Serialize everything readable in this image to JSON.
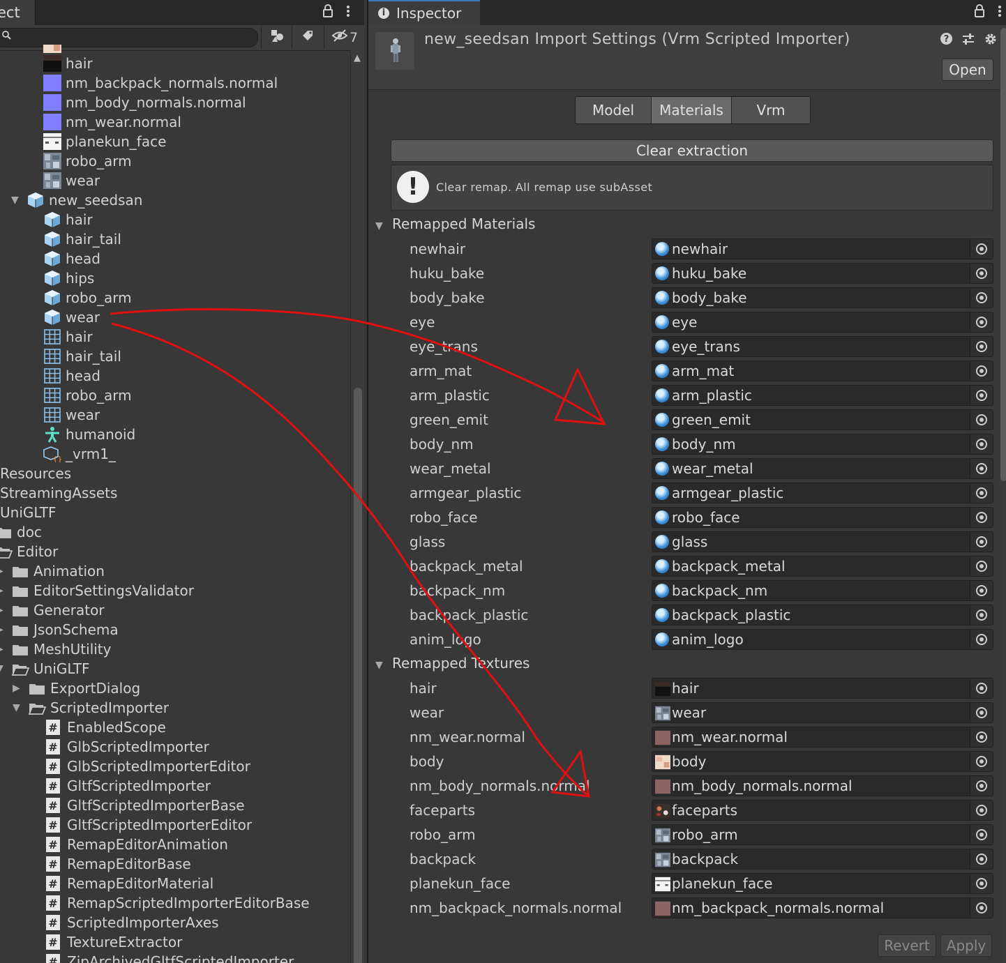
{
  "project": {
    "tab_label": "ect",
    "tab_icons": [
      "lock-icon",
      "kebab-menu-icon"
    ],
    "search_placeholder": "",
    "toolbar": {
      "hidden_count": "7"
    },
    "tree": [
      {
        "label": "hair",
        "icon": "texture-dark",
        "indent": 62
      },
      {
        "label": "nm_backpack_normals.normal",
        "icon": "texture-normal",
        "indent": 62
      },
      {
        "label": "nm_body_normals.normal",
        "icon": "texture-normal",
        "indent": 62
      },
      {
        "label": "nm_wear.normal",
        "icon": "texture-normal",
        "indent": 62
      },
      {
        "label": "planekun_face",
        "icon": "texture-face",
        "indent": 62
      },
      {
        "label": "robo_arm",
        "icon": "texture-robo",
        "indent": 62
      },
      {
        "label": "wear",
        "icon": "texture-robo",
        "indent": 62
      },
      {
        "label": "new_seedsan",
        "icon": "prefab",
        "indent": 38,
        "arrow": "down"
      },
      {
        "label": "hair",
        "icon": "prefab",
        "indent": 62
      },
      {
        "label": "hair_tail",
        "icon": "prefab",
        "indent": 62
      },
      {
        "label": "head",
        "icon": "prefab",
        "indent": 62
      },
      {
        "label": "hips",
        "icon": "prefab",
        "indent": 62
      },
      {
        "label": "robo_arm",
        "icon": "prefab",
        "indent": 62
      },
      {
        "label": "wear",
        "icon": "prefab",
        "indent": 62
      },
      {
        "label": "hair",
        "icon": "mesh",
        "indent": 62
      },
      {
        "label": "hair_tail",
        "icon": "mesh",
        "indent": 62
      },
      {
        "label": "head",
        "icon": "mesh",
        "indent": 62
      },
      {
        "label": "robo_arm",
        "icon": "mesh",
        "indent": 62
      },
      {
        "label": "wear",
        "icon": "mesh",
        "indent": 62
      },
      {
        "label": "humanoid",
        "icon": "humanoid",
        "indent": 62
      },
      {
        "label": "_vrm1_",
        "icon": "vrm",
        "indent": 62
      },
      {
        "label": "Resources",
        "icon": "none",
        "indent": 0
      },
      {
        "label": "StreamingAssets",
        "icon": "none",
        "indent": 0
      },
      {
        "label": "UniGLTF",
        "icon": "none",
        "indent": 0
      },
      {
        "label": "doc",
        "icon": "folder",
        "indent": -8
      },
      {
        "label": "Editor",
        "icon": "folder-open",
        "indent": -8
      },
      {
        "label": "Animation",
        "icon": "folder",
        "indent": 16,
        "arrow": "right"
      },
      {
        "label": "EditorSettingsValidator",
        "icon": "folder",
        "indent": 16,
        "arrow": "right"
      },
      {
        "label": "Generator",
        "icon": "folder",
        "indent": 16,
        "arrow": "right"
      },
      {
        "label": "JsonSchema",
        "icon": "folder",
        "indent": 16,
        "arrow": "right"
      },
      {
        "label": "MeshUtility",
        "icon": "folder",
        "indent": 16,
        "arrow": "right"
      },
      {
        "label": "UniGLTF",
        "icon": "folder-open",
        "indent": 16,
        "arrow": "down"
      },
      {
        "label": "ExportDialog",
        "icon": "folder",
        "indent": 40,
        "arrow": "right"
      },
      {
        "label": "ScriptedImporter",
        "icon": "folder-open",
        "indent": 40,
        "arrow": "down"
      },
      {
        "label": "EnabledScope",
        "icon": "script",
        "indent": 64
      },
      {
        "label": "GlbScriptedImporter",
        "icon": "script",
        "indent": 64
      },
      {
        "label": "GlbScriptedImporterEditor",
        "icon": "script",
        "indent": 64
      },
      {
        "label": "GltfScriptedImporter",
        "icon": "script",
        "indent": 64
      },
      {
        "label": "GltfScriptedImporterBase",
        "icon": "script",
        "indent": 64
      },
      {
        "label": "GltfScriptedImporterEditor",
        "icon": "script",
        "indent": 64
      },
      {
        "label": "RemapEditorAnimation",
        "icon": "script",
        "indent": 64
      },
      {
        "label": "RemapEditorBase",
        "icon": "script",
        "indent": 64
      },
      {
        "label": "RemapEditorMaterial",
        "icon": "script",
        "indent": 64
      },
      {
        "label": "RemapScriptedImporterEditorBase",
        "icon": "script",
        "indent": 64
      },
      {
        "label": "ScriptedImporterAxes",
        "icon": "script",
        "indent": 64
      },
      {
        "label": "TextureExtractor",
        "icon": "script",
        "indent": 64
      },
      {
        "label": "ZipArchivedGltfScriptedImporter",
        "icon": "script",
        "indent": 64
      }
    ]
  },
  "inspector": {
    "tab_label": "Inspector",
    "title": "new_seedsan Import Settings (Vrm Scripted Importer)",
    "header_icons": [
      "help-icon",
      "presets-icon",
      "settings-icon"
    ],
    "open_label": "Open",
    "tabs": [
      {
        "label": "Model",
        "active": false
      },
      {
        "label": "Materials",
        "active": true
      },
      {
        "label": "Vrm",
        "active": false
      }
    ],
    "clear_extraction_label": "Clear extraction",
    "help_text": "Clear remap. All remap use subAsset",
    "materials_section": "Remapped Materials",
    "materials": [
      {
        "label": "newhair",
        "value": "newhair"
      },
      {
        "label": "huku_bake",
        "value": "huku_bake"
      },
      {
        "label": "body_bake",
        "value": "body_bake"
      },
      {
        "label": "eye",
        "value": "eye"
      },
      {
        "label": "eye_trans",
        "value": "eye_trans"
      },
      {
        "label": "arm_mat",
        "value": "arm_mat"
      },
      {
        "label": "arm_plastic",
        "value": "arm_plastic"
      },
      {
        "label": "green_emit",
        "value": "green_emit"
      },
      {
        "label": "body_nm",
        "value": "body_nm"
      },
      {
        "label": "wear_metal",
        "value": "wear_metal"
      },
      {
        "label": "armgear_plastic",
        "value": "armgear_plastic"
      },
      {
        "label": "robo_face",
        "value": "robo_face"
      },
      {
        "label": "glass",
        "value": "glass"
      },
      {
        "label": "backpack_metal",
        "value": "backpack_metal"
      },
      {
        "label": "backpack_nm",
        "value": "backpack_nm"
      },
      {
        "label": "backpack_plastic",
        "value": "backpack_plastic"
      },
      {
        "label": "anim_logo",
        "value": "anim_logo"
      }
    ],
    "textures_section": "Remapped Textures",
    "textures": [
      {
        "label": "hair",
        "value": "hair",
        "icon": "texture-dark"
      },
      {
        "label": "wear",
        "value": "wear",
        "icon": "texture-robo"
      },
      {
        "label": "nm_wear.normal",
        "value": "nm_wear.normal",
        "icon": "texture-pink"
      },
      {
        "label": "body",
        "value": "body",
        "icon": "texture-skin"
      },
      {
        "label": "nm_body_normals.normal",
        "value": "nm_body_normals.normal",
        "icon": "texture-pink"
      },
      {
        "label": "faceparts",
        "value": "faceparts",
        "icon": "texture-face-parts"
      },
      {
        "label": "robo_arm",
        "value": "robo_arm",
        "icon": "texture-robo"
      },
      {
        "label": "backpack",
        "value": "backpack",
        "icon": "texture-robo"
      },
      {
        "label": "planekun_face",
        "value": "planekun_face",
        "icon": "texture-face"
      },
      {
        "label": "nm_backpack_normals.normal",
        "value": "nm_backpack_normals.normal",
        "icon": "texture-pink"
      }
    ],
    "revert_label": "Revert",
    "apply_label": "Apply"
  },
  "colors": {
    "panel_bg": "#383838",
    "field_bg": "#2a2a2a",
    "tab_accent": "#3a79bb",
    "annotation": "#e01010"
  }
}
